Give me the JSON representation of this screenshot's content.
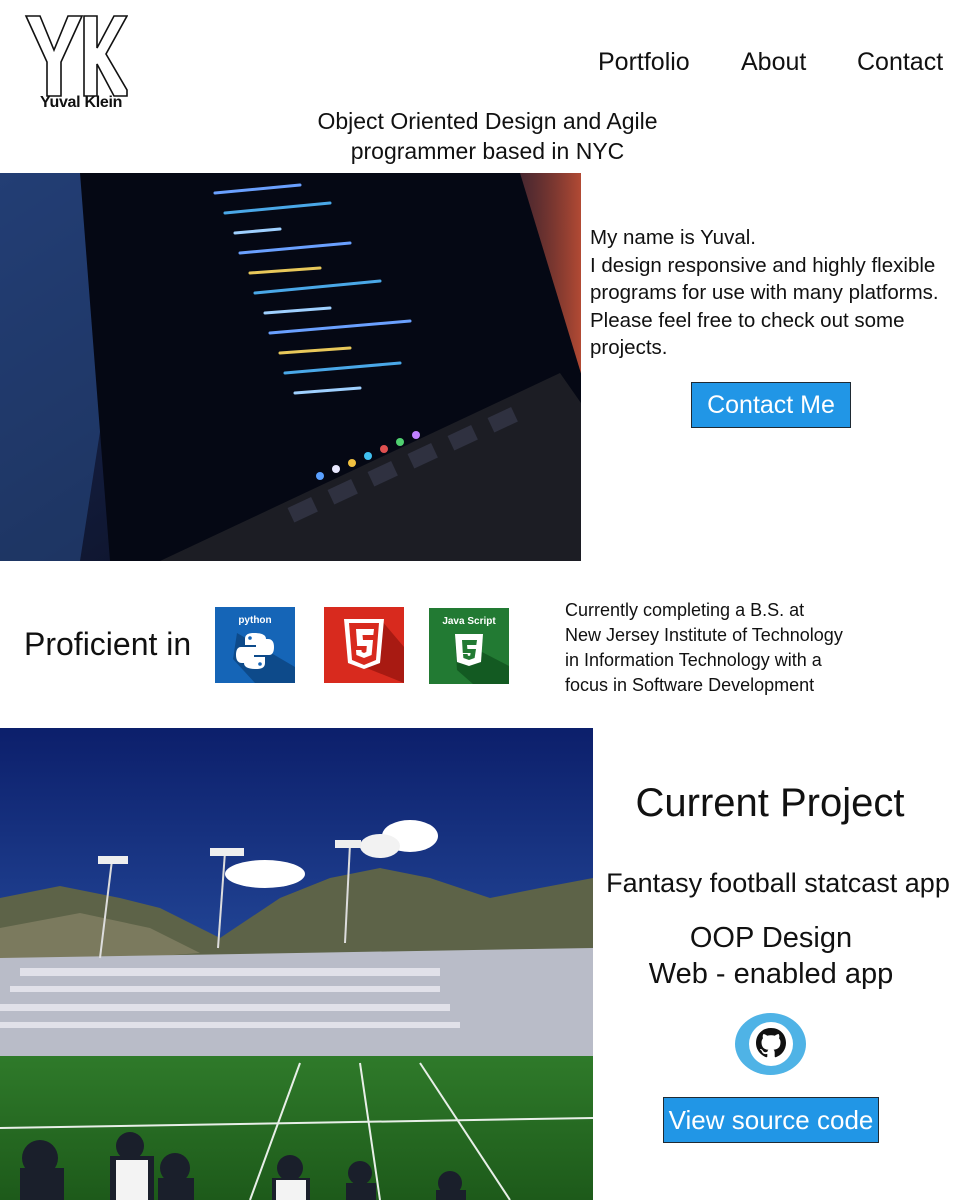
{
  "header": {
    "logo_name": "Yuval Klein",
    "nav": [
      "Portfolio",
      "About",
      "Contact"
    ],
    "tagline_line1": "Object Oriented Design and Agile",
    "tagline_line2": "programmer based in NYC"
  },
  "hero": {
    "image": "laptop-code-photo",
    "bio_line1": "My name is Yuval.",
    "bio_line2": "I design responsive and highly flexible programs for use with many platforms. Please feel free to check out some projects.",
    "contact_button": "Contact Me"
  },
  "skills": {
    "heading": "Proficient in",
    "items": [
      {
        "name": "python",
        "icon": "python-icon",
        "color": "#1565b7"
      },
      {
        "name": "",
        "icon": "html5-icon",
        "color": "#d82a1e"
      },
      {
        "name": "Java Script",
        "icon": "javascript-icon",
        "color": "#227a33"
      }
    ]
  },
  "education": {
    "line1": "Currently completing a B.S. at",
    "line2": "New Jersey Institute of Technology",
    "line3": "in Information Technology with a",
    "line4": "focus in Software Development"
  },
  "project": {
    "image": "football-stadium-photo",
    "title": "Current Project",
    "app_name": "Fantasy football statcast app",
    "feature1": "OOP Design",
    "feature2": "Web - enabled app",
    "github_icon": "github-icon",
    "source_button": "View source code"
  },
  "colors": {
    "button_blue": "#2196e6",
    "github_circle": "#4fb3e6"
  }
}
